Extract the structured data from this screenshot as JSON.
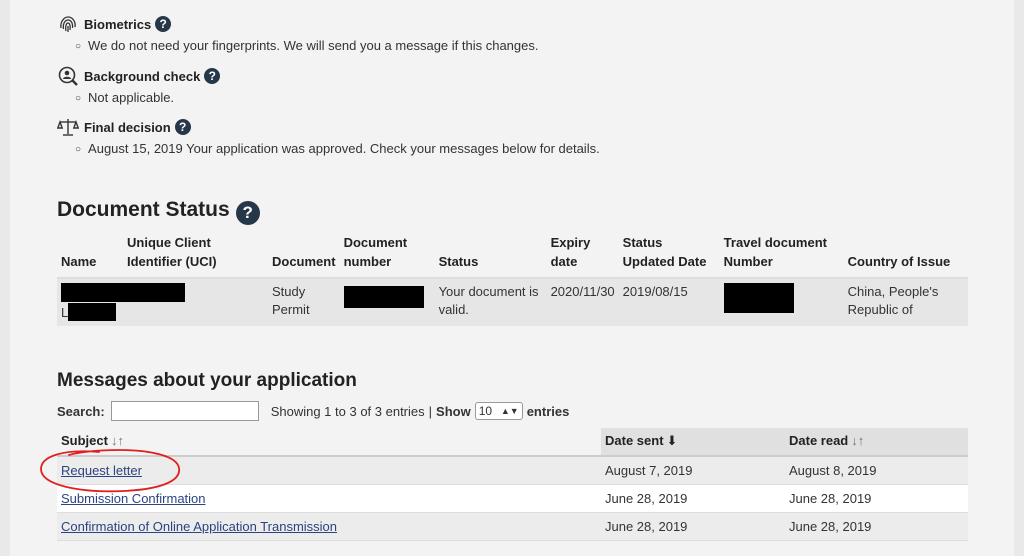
{
  "steps": [
    {
      "title": "Biometrics",
      "icon": "fingerprint-icon",
      "text": "We do not need your fingerprints. We will send you a message if this changes."
    },
    {
      "title": "Background check",
      "icon": "magnifier-person-icon",
      "text": "Not applicable."
    },
    {
      "title": "Final decision",
      "icon": "scales-icon",
      "text": "August 15, 2019 Your application was approved. Check your messages below for details."
    }
  ],
  "help_glyph": "?",
  "document_status": {
    "heading": "Document Status",
    "columns": [
      "Name",
      "Unique Client Identifier (UCI)",
      "Document",
      "Document number",
      "Status",
      "Expiry date",
      "Status Updated Date",
      "Travel document Number",
      "Country of Issue"
    ],
    "row": {
      "name_initial": "L",
      "document": "Study Permit",
      "status": "Your document is valid.",
      "expiry": "2020/11/30",
      "updated": "2019/08/15",
      "country": "China, People's Republic of"
    }
  },
  "messages": {
    "heading": "Messages about your application",
    "search_label": "Search:",
    "search_value": "",
    "info": "Showing 1 to 3 of 3 entries",
    "separator": "|",
    "show_label": "Show",
    "entries_value": "10",
    "entries_label": "entries",
    "columns": {
      "subject": "Subject",
      "date_sent": "Date sent",
      "date_read": "Date read"
    },
    "sort_icons": {
      "subject": "↓↑",
      "date_sent": "⬇",
      "date_read": "↓↑"
    },
    "rows": [
      {
        "subject": "Request letter",
        "sent": "August 7, 2019",
        "read": "August 8, 2019"
      },
      {
        "subject": "Submission Confirmation",
        "sent": "June 28, 2019",
        "read": "June 28, 2019"
      },
      {
        "subject": "Confirmation of Online Application Transmission",
        "sent": "June 28, 2019",
        "read": "June 28, 2019"
      }
    ]
  },
  "colors": {
    "help_badge": "#26374a",
    "link": "#2b4380",
    "annotation": "#e02020"
  }
}
